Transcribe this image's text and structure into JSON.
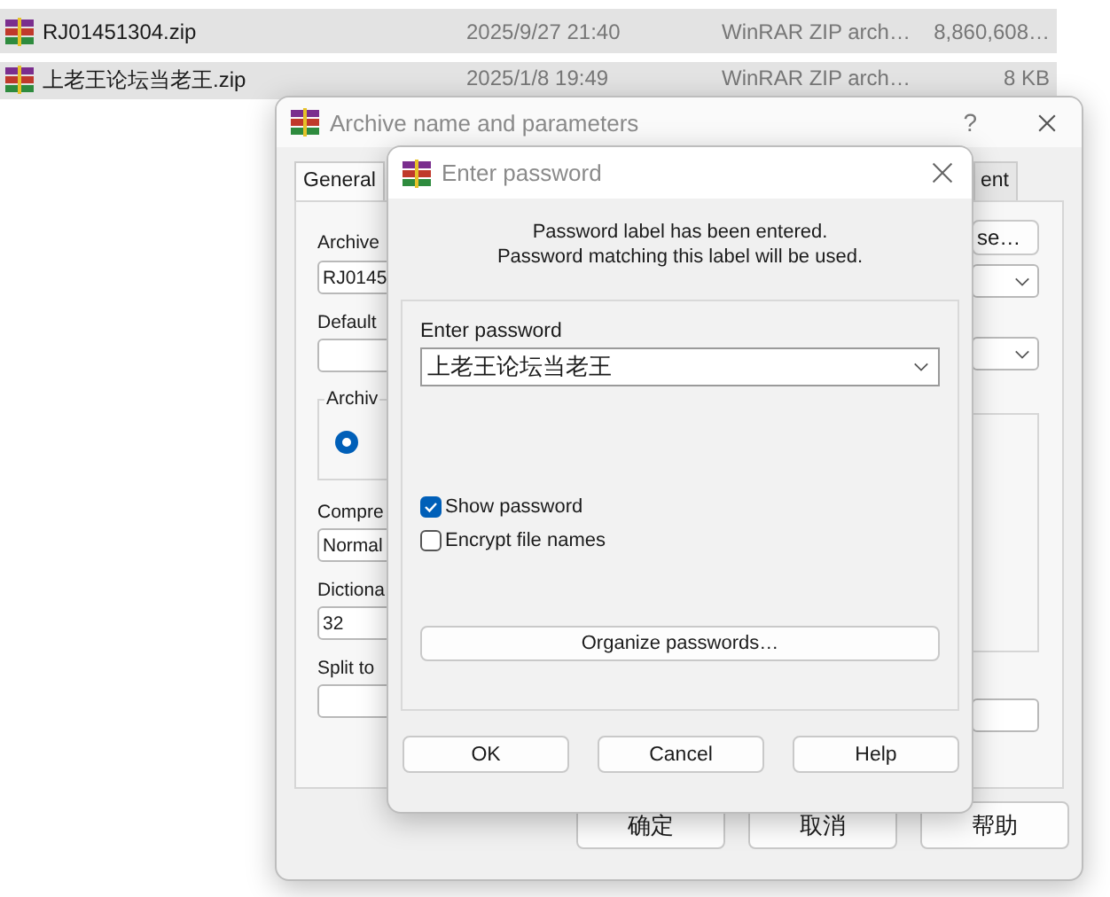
{
  "file_list": {
    "rows": [
      {
        "name": "RJ01451304.zip",
        "modified": "2025/9/27 21:40",
        "type": "WinRAR ZIP arch…",
        "size": "8,860,608…",
        "selected": true
      },
      {
        "name": "上老王论坛当老王.zip",
        "modified": "2025/1/8 19:49",
        "type": "WinRAR ZIP arch…",
        "size": "8 KB",
        "selected": true
      }
    ]
  },
  "archive_window": {
    "title": "Archive name and parameters",
    "help": "?",
    "tabs": [
      {
        "label": "General",
        "selected": true
      },
      {
        "label": "ent",
        "selected": false
      }
    ],
    "archive_name_label": "Archive",
    "archive_name": "RJ0145",
    "browse_button": "se…",
    "default_label": "Default",
    "format_group": "Archiv",
    "format_radio": {
      "selected": true
    },
    "compression_label": "Compre",
    "compression": "Normal",
    "dictionary_label": "Dictiona",
    "dictionary": "32",
    "split_label": "Split to",
    "buttons": [
      "确定",
      "取消",
      "帮助"
    ]
  },
  "password_dialog": {
    "title": "Enter password",
    "message": [
      "Password label has been entered.",
      "Password matching this label will be used."
    ],
    "password_label": "Enter password",
    "password_value": "上老王论坛当老王",
    "options": [
      {
        "label": "Show password",
        "checked": true
      },
      {
        "label": "Encrypt file names",
        "checked": false
      }
    ],
    "organize_button": "Organize passwords…",
    "buttons": [
      "OK",
      "Cancel",
      "Help"
    ]
  }
}
